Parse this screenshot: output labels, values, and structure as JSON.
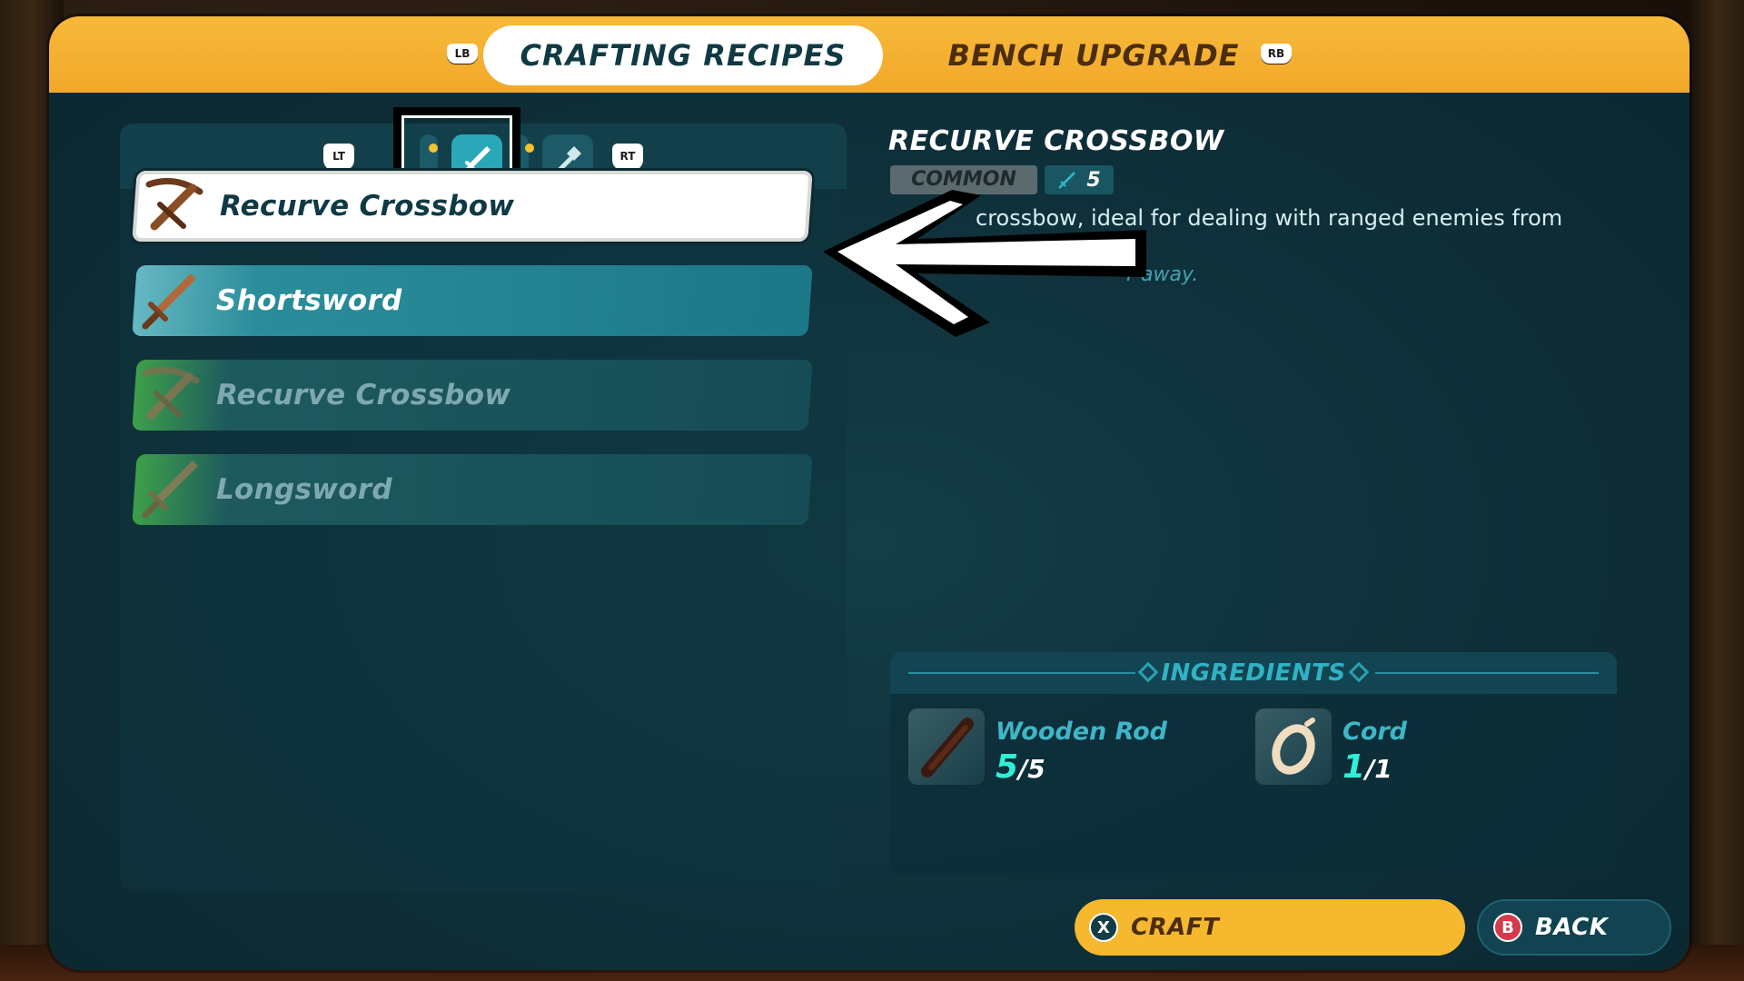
{
  "header": {
    "lb_hint": "LB",
    "rb_hint": "RB",
    "tab_active": "CRAFTING RECIPES",
    "tab_inactive": "BENCH UPGRADE"
  },
  "categories": {
    "lt_hint": "LT",
    "rt_hint": "RT",
    "icons": [
      "partial-tab",
      "sword-icon",
      "partial-tab",
      "hammer-icon"
    ],
    "active_index": 1
  },
  "recipes": [
    {
      "label": "Recurve Crossbow",
      "state": "selected",
      "icon": "crossbow-icon"
    },
    {
      "label": "Shortsword",
      "state": "available",
      "icon": "sword-icon"
    },
    {
      "label": "Recurve Crossbow",
      "state": "locked",
      "icon": "crossbow-icon"
    },
    {
      "label": "Longsword",
      "state": "locked",
      "icon": "sword-icon"
    }
  ],
  "detail": {
    "title": "RECURVE CROSSBOW",
    "rarity": "COMMON",
    "power": "5",
    "description": "crossbow, ideal for dealing with ranged enemies from",
    "flavor": "r away."
  },
  "ingredients": {
    "title": "INGREDIENTS",
    "items": [
      {
        "name": "Wooden Rod",
        "have": "5",
        "need": "5",
        "icon": "wooden-rod-icon"
      },
      {
        "name": "Cord",
        "have": "1",
        "need": "1",
        "icon": "cord-icon"
      }
    ]
  },
  "buttons": {
    "craft_glyph": "X",
    "craft_label": "CRAFT",
    "back_glyph": "B",
    "back_label": "BACK"
  },
  "colors": {
    "accent_orange": "#f5b82e",
    "panel_teal": "#0f313b",
    "highlight_teal": "#2aa8b8",
    "count_green": "#2ef0d8"
  }
}
